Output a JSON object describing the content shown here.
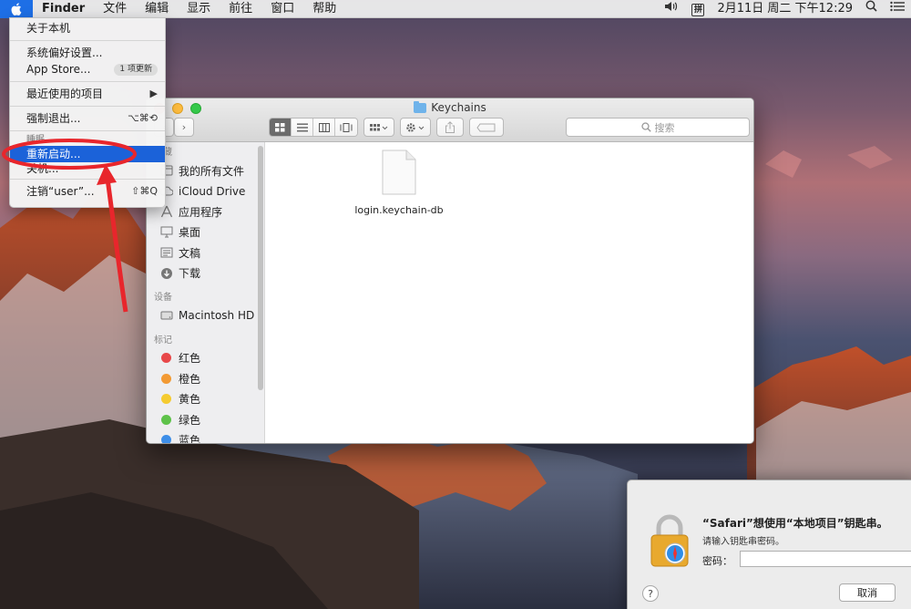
{
  "menubar": {
    "app_name": "Finder",
    "items": [
      "文件",
      "编辑",
      "显示",
      "前往",
      "窗口",
      "帮助"
    ],
    "input_method": "拼",
    "clock": "2月11日 周二 下午12:29"
  },
  "apple_menu": {
    "items": [
      {
        "label": "关于本机"
      },
      {
        "label": "系统偏好设置..."
      },
      {
        "label": "App Store...",
        "badge": "1 项更新"
      },
      {
        "label": "最近使用的项目",
        "submenu": "▶"
      },
      {
        "label": "强制退出...",
        "shortcut": "⌥⌘⟲"
      },
      {
        "label": "睡眠"
      },
      {
        "label": "重新启动..."
      },
      {
        "label": "关机..."
      },
      {
        "label": "注销“user”...",
        "shortcut": "⇧⌘Q"
      }
    ]
  },
  "finder": {
    "title": "Keychains",
    "search_placeholder": "搜索",
    "sidebar": {
      "favorites_header": "收藏",
      "favorites": [
        "我的所有文件",
        "iCloud Drive",
        "应用程序",
        "桌面",
        "文稿",
        "下载"
      ],
      "devices_header": "设备",
      "devices": [
        "Macintosh HD"
      ],
      "tags_header": "标记",
      "tags": [
        {
          "label": "红色",
          "color": "#e8484a"
        },
        {
          "label": "橙色",
          "color": "#f29a34"
        },
        {
          "label": "黄色",
          "color": "#f5cb30"
        },
        {
          "label": "绿色",
          "color": "#5ec24a"
        },
        {
          "label": "蓝色",
          "color": "#3d8ee8"
        }
      ]
    },
    "file": {
      "name": "login.keychain-db"
    }
  },
  "dialog": {
    "title": "“Safari”想使用“本地项目”钥匙串。",
    "subtitle": "请输入钥匙串密码。",
    "password_label": "密码：",
    "help": "?",
    "cancel": "取消"
  },
  "colors": {
    "highlight": "#1b62d9",
    "annotation": "#e8262c"
  }
}
